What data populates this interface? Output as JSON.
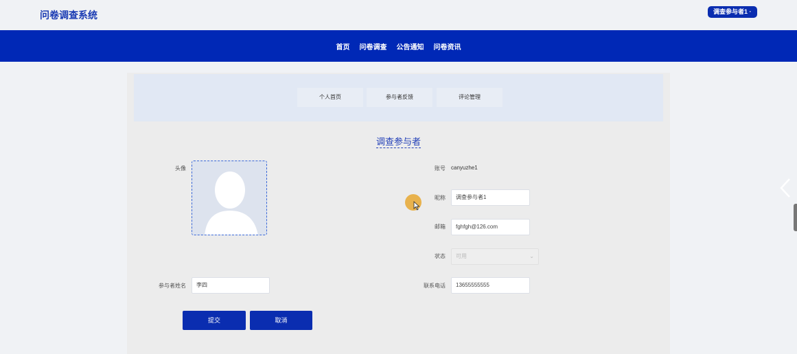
{
  "header": {
    "app_title": "问卷调查系统",
    "user_badge": "调查参与者1 ·"
  },
  "nav": {
    "items": [
      "首页",
      "问卷调查",
      "公告通知",
      "问卷资讯"
    ]
  },
  "subnav": {
    "tabs": [
      "个人首页",
      "参与者反馈",
      "评论管理"
    ]
  },
  "form": {
    "title": "调查参与者",
    "avatar_label": "头像",
    "account_label": "账号",
    "account_value": "canyuzhe1",
    "nickname_label": "昵称",
    "nickname_value": "调查参与者1",
    "email_label": "邮箱",
    "email_value": "fghfgh@126.com",
    "status_label": "状态",
    "status_value": "可用",
    "name_label": "参与者姓名",
    "name_value": "李四",
    "phone_label": "联系电话",
    "phone_value": "13655555555"
  },
  "buttons": {
    "submit": "提交",
    "cancel": "取消"
  },
  "colors": {
    "primary": "#0028b6",
    "title_blue": "#1a3bb3",
    "cursor_highlight": "#e8ac3c"
  },
  "icons": {
    "avatar": "user-silhouette-icon",
    "next": "chevron-right-icon",
    "caret": "chevron-down-icon"
  }
}
